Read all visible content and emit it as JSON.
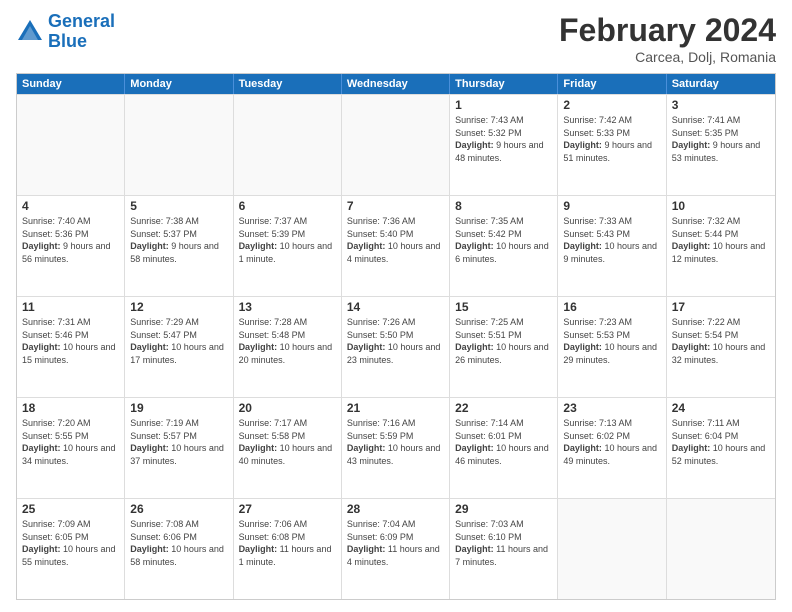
{
  "logo": {
    "line1": "General",
    "line2": "Blue"
  },
  "title": "February 2024",
  "location": "Carcea, Dolj, Romania",
  "weekdays": [
    "Sunday",
    "Monday",
    "Tuesday",
    "Wednesday",
    "Thursday",
    "Friday",
    "Saturday"
  ],
  "rows": [
    [
      {
        "day": "",
        "sunrise": "",
        "sunset": "",
        "daylight": ""
      },
      {
        "day": "",
        "sunrise": "",
        "sunset": "",
        "daylight": ""
      },
      {
        "day": "",
        "sunrise": "",
        "sunset": "",
        "daylight": ""
      },
      {
        "day": "",
        "sunrise": "",
        "sunset": "",
        "daylight": ""
      },
      {
        "day": "1",
        "sunrise": "Sunrise: 7:43 AM",
        "sunset": "Sunset: 5:32 PM",
        "daylight": "Daylight: 9 hours and 48 minutes."
      },
      {
        "day": "2",
        "sunrise": "Sunrise: 7:42 AM",
        "sunset": "Sunset: 5:33 PM",
        "daylight": "Daylight: 9 hours and 51 minutes."
      },
      {
        "day": "3",
        "sunrise": "Sunrise: 7:41 AM",
        "sunset": "Sunset: 5:35 PM",
        "daylight": "Daylight: 9 hours and 53 minutes."
      }
    ],
    [
      {
        "day": "4",
        "sunrise": "Sunrise: 7:40 AM",
        "sunset": "Sunset: 5:36 PM",
        "daylight": "Daylight: 9 hours and 56 minutes."
      },
      {
        "day": "5",
        "sunrise": "Sunrise: 7:38 AM",
        "sunset": "Sunset: 5:37 PM",
        "daylight": "Daylight: 9 hours and 58 minutes."
      },
      {
        "day": "6",
        "sunrise": "Sunrise: 7:37 AM",
        "sunset": "Sunset: 5:39 PM",
        "daylight": "Daylight: 10 hours and 1 minute."
      },
      {
        "day": "7",
        "sunrise": "Sunrise: 7:36 AM",
        "sunset": "Sunset: 5:40 PM",
        "daylight": "Daylight: 10 hours and 4 minutes."
      },
      {
        "day": "8",
        "sunrise": "Sunrise: 7:35 AM",
        "sunset": "Sunset: 5:42 PM",
        "daylight": "Daylight: 10 hours and 6 minutes."
      },
      {
        "day": "9",
        "sunrise": "Sunrise: 7:33 AM",
        "sunset": "Sunset: 5:43 PM",
        "daylight": "Daylight: 10 hours and 9 minutes."
      },
      {
        "day": "10",
        "sunrise": "Sunrise: 7:32 AM",
        "sunset": "Sunset: 5:44 PM",
        "daylight": "Daylight: 10 hours and 12 minutes."
      }
    ],
    [
      {
        "day": "11",
        "sunrise": "Sunrise: 7:31 AM",
        "sunset": "Sunset: 5:46 PM",
        "daylight": "Daylight: 10 hours and 15 minutes."
      },
      {
        "day": "12",
        "sunrise": "Sunrise: 7:29 AM",
        "sunset": "Sunset: 5:47 PM",
        "daylight": "Daylight: 10 hours and 17 minutes."
      },
      {
        "day": "13",
        "sunrise": "Sunrise: 7:28 AM",
        "sunset": "Sunset: 5:48 PM",
        "daylight": "Daylight: 10 hours and 20 minutes."
      },
      {
        "day": "14",
        "sunrise": "Sunrise: 7:26 AM",
        "sunset": "Sunset: 5:50 PM",
        "daylight": "Daylight: 10 hours and 23 minutes."
      },
      {
        "day": "15",
        "sunrise": "Sunrise: 7:25 AM",
        "sunset": "Sunset: 5:51 PM",
        "daylight": "Daylight: 10 hours and 26 minutes."
      },
      {
        "day": "16",
        "sunrise": "Sunrise: 7:23 AM",
        "sunset": "Sunset: 5:53 PM",
        "daylight": "Daylight: 10 hours and 29 minutes."
      },
      {
        "day": "17",
        "sunrise": "Sunrise: 7:22 AM",
        "sunset": "Sunset: 5:54 PM",
        "daylight": "Daylight: 10 hours and 32 minutes."
      }
    ],
    [
      {
        "day": "18",
        "sunrise": "Sunrise: 7:20 AM",
        "sunset": "Sunset: 5:55 PM",
        "daylight": "Daylight: 10 hours and 34 minutes."
      },
      {
        "day": "19",
        "sunrise": "Sunrise: 7:19 AM",
        "sunset": "Sunset: 5:57 PM",
        "daylight": "Daylight: 10 hours and 37 minutes."
      },
      {
        "day": "20",
        "sunrise": "Sunrise: 7:17 AM",
        "sunset": "Sunset: 5:58 PM",
        "daylight": "Daylight: 10 hours and 40 minutes."
      },
      {
        "day": "21",
        "sunrise": "Sunrise: 7:16 AM",
        "sunset": "Sunset: 5:59 PM",
        "daylight": "Daylight: 10 hours and 43 minutes."
      },
      {
        "day": "22",
        "sunrise": "Sunrise: 7:14 AM",
        "sunset": "Sunset: 6:01 PM",
        "daylight": "Daylight: 10 hours and 46 minutes."
      },
      {
        "day": "23",
        "sunrise": "Sunrise: 7:13 AM",
        "sunset": "Sunset: 6:02 PM",
        "daylight": "Daylight: 10 hours and 49 minutes."
      },
      {
        "day": "24",
        "sunrise": "Sunrise: 7:11 AM",
        "sunset": "Sunset: 6:04 PM",
        "daylight": "Daylight: 10 hours and 52 minutes."
      }
    ],
    [
      {
        "day": "25",
        "sunrise": "Sunrise: 7:09 AM",
        "sunset": "Sunset: 6:05 PM",
        "daylight": "Daylight: 10 hours and 55 minutes."
      },
      {
        "day": "26",
        "sunrise": "Sunrise: 7:08 AM",
        "sunset": "Sunset: 6:06 PM",
        "daylight": "Daylight: 10 hours and 58 minutes."
      },
      {
        "day": "27",
        "sunrise": "Sunrise: 7:06 AM",
        "sunset": "Sunset: 6:08 PM",
        "daylight": "Daylight: 11 hours and 1 minute."
      },
      {
        "day": "28",
        "sunrise": "Sunrise: 7:04 AM",
        "sunset": "Sunset: 6:09 PM",
        "daylight": "Daylight: 11 hours and 4 minutes."
      },
      {
        "day": "29",
        "sunrise": "Sunrise: 7:03 AM",
        "sunset": "Sunset: 6:10 PM",
        "daylight": "Daylight: 11 hours and 7 minutes."
      },
      {
        "day": "",
        "sunrise": "",
        "sunset": "",
        "daylight": ""
      },
      {
        "day": "",
        "sunrise": "",
        "sunset": "",
        "daylight": ""
      }
    ]
  ]
}
